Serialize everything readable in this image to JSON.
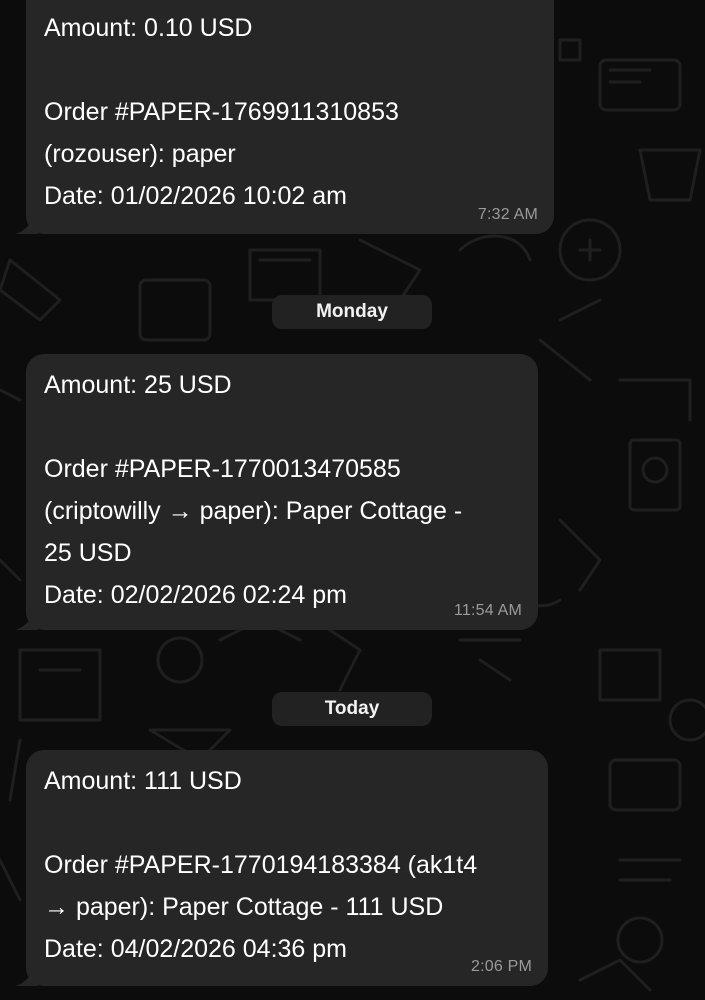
{
  "messages": [
    {
      "amount": "Amount: 0.10 USD",
      "order_line1": "Order #PAPER-1769911310853",
      "order_line2": "(rozouser): paper",
      "date": "Date: 01/02/2026 10:02 am",
      "time": "7:32 AM"
    },
    {
      "amount": "Amount: 25 USD",
      "order_line1": "Order #PAPER-1770013470585",
      "order_line2": "(criptowilly → paper): Paper Cottage -",
      "order_line3": "25 USD",
      "date": "Date: 02/02/2026 02:24 pm",
      "time": "11:54 AM"
    },
    {
      "amount": "Amount: 111 USD",
      "order_line1": "Order #PAPER-1770194183384 (ak1t4",
      "order_line2": "→ paper): Paper Cottage - 111 USD",
      "date": "Date: 04/02/2026 04:36 pm",
      "time": "2:06 PM"
    }
  ],
  "dividers": {
    "monday": "Monday",
    "today": "Today"
  },
  "colors": {
    "background": "#0c0c0c",
    "bubble": "#262626",
    "text": "#ffffff",
    "timestamp": "#9a9a9a",
    "divider": "#222222"
  }
}
